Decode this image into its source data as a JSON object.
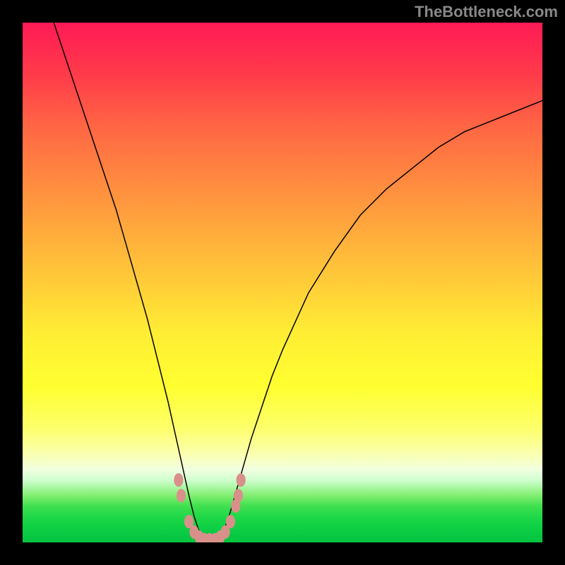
{
  "watermark": "TheBottleneck.com",
  "chart_data": {
    "type": "line",
    "title": "",
    "xlabel": "",
    "ylabel": "",
    "xlim": [
      0,
      100
    ],
    "ylim": [
      0,
      100
    ],
    "series": [
      {
        "name": "bottleneck-curve",
        "x": [
          6,
          8,
          10,
          12,
          14,
          16,
          18,
          20,
          22,
          24,
          26,
          28,
          30,
          32,
          33,
          34,
          35,
          36,
          37,
          38,
          39,
          40,
          42,
          44,
          46,
          48,
          50,
          55,
          60,
          65,
          70,
          75,
          80,
          85,
          90,
          95,
          100
        ],
        "values": [
          100,
          94,
          88,
          82,
          76,
          70,
          64,
          57,
          50,
          43,
          35,
          27,
          18,
          9,
          5,
          2,
          0,
          0,
          0,
          1,
          3,
          6,
          13,
          20,
          26,
          32,
          37,
          48,
          56,
          63,
          68,
          72,
          76,
          79,
          81,
          83,
          85
        ]
      }
    ],
    "markers": {
      "name": "highlight-dots",
      "points": [
        {
          "x": 30,
          "y": 12
        },
        {
          "x": 30.5,
          "y": 9
        },
        {
          "x": 32,
          "y": 4
        },
        {
          "x": 33,
          "y": 2
        },
        {
          "x": 34,
          "y": 1
        },
        {
          "x": 35,
          "y": 0.5
        },
        {
          "x": 36,
          "y": 0.5
        },
        {
          "x": 37,
          "y": 0.5
        },
        {
          "x": 38,
          "y": 1
        },
        {
          "x": 39,
          "y": 2
        },
        {
          "x": 40,
          "y": 4
        },
        {
          "x": 41,
          "y": 7
        },
        {
          "x": 41.5,
          "y": 9
        },
        {
          "x": 42,
          "y": 12
        }
      ],
      "color": "#d9908a"
    },
    "gradient": {
      "top_color": "#ff1a55",
      "bottom_color": "#06c540"
    }
  }
}
